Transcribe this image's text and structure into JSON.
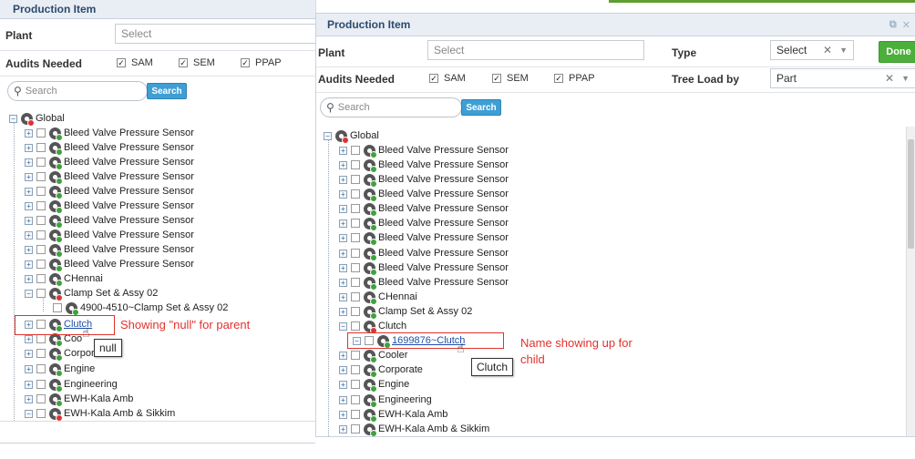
{
  "left_panel": {
    "title": "Production Item",
    "plant_label": "Plant",
    "plant_placeholder": "Select",
    "audits_label": "Audits Needed",
    "audits": [
      {
        "label": "SAM",
        "checked": true
      },
      {
        "label": "SEM",
        "checked": true
      },
      {
        "label": "PPAP",
        "checked": true
      }
    ],
    "search_placeholder": "Search",
    "search_button": "Search",
    "tree": {
      "root": "Global",
      "items": [
        "Bleed Valve Pressure Sensor",
        "Bleed Valve Pressure Sensor",
        "Bleed Valve Pressure Sensor",
        "Bleed Valve Pressure Sensor",
        "Bleed Valve Pressure Sensor",
        "Bleed Valve Pressure Sensor",
        "Bleed Valve Pressure Sensor",
        "Bleed Valve Pressure Sensor",
        "Bleed Valve Pressure Sensor",
        "Bleed Valve Pressure Sensor",
        "CHennai",
        "Clamp Set & Assy 02",
        "4900-4510~Clamp Set & Assy 02",
        "Clutch",
        "Coo",
        "Corpora",
        "Engine",
        "Engineering",
        "EWH-Kala Amb",
        "EWH-Kala Amb & Sikkim"
      ]
    },
    "tooltip": "null",
    "annotation": "Showing \"null\" for parent"
  },
  "right_panel": {
    "title": "Production Item",
    "plant_label": "Plant",
    "plant_placeholder": "Select",
    "type_label": "Type",
    "type_value": "Select",
    "done_button": "Done",
    "audits_label": "Audits Needed",
    "audits": [
      {
        "label": "SAM",
        "checked": true
      },
      {
        "label": "SEM",
        "checked": true
      },
      {
        "label": "PPAP",
        "checked": true
      }
    ],
    "tree_load_label": "Tree Load by",
    "tree_load_value": "Part",
    "search_placeholder": "Search",
    "search_button": "Search",
    "tree": {
      "root": "Global",
      "items": [
        "Bleed Valve Pressure Sensor",
        "Bleed Valve Pressure Sensor",
        "Bleed Valve Pressure Sensor",
        "Bleed Valve Pressure Sensor",
        "Bleed Valve Pressure Sensor",
        "Bleed Valve Pressure Sensor",
        "Bleed Valve Pressure Sensor",
        "Bleed Valve Pressure Sensor",
        "Bleed Valve Pressure Sensor",
        "Bleed Valve Pressure Sensor",
        "CHennai",
        "Clamp Set & Assy 02",
        "Clutch",
        "1699876~Clutch",
        "Cooler",
        "Corporate",
        "Engine",
        "Engineering",
        "EWH-Kala Amb",
        "EWH-Kala Amb & Sikkim"
      ]
    },
    "tooltip": "Clutch",
    "annotation_line1": "Name showing up for",
    "annotation_line2": "child"
  },
  "colors": {
    "accent_blue": "#3f9fd4",
    "done_green": "#4caf3c",
    "annotation_red": "#e0322e",
    "title_text": "#2d4a6c"
  }
}
